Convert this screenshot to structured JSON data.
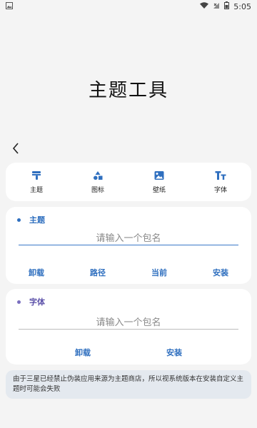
{
  "status_bar": {
    "time": "5:05",
    "icons": [
      "image-icon",
      "wifi-icon",
      "signal-x-icon",
      "battery-icon"
    ]
  },
  "page_title": "主题工具",
  "nav": {
    "items": [
      {
        "label": "主题",
        "icon": "theme-icon"
      },
      {
        "label": "图标",
        "icon": "icons-icon"
      },
      {
        "label": "壁纸",
        "icon": "wallpaper-icon"
      },
      {
        "label": "字体",
        "icon": "font-icon"
      }
    ]
  },
  "theme_section": {
    "title": "主题",
    "input_placeholder": "请输入一个包名",
    "actions": [
      "卸载",
      "路径",
      "当前",
      "安装"
    ]
  },
  "font_section": {
    "title": "字体",
    "input_placeholder": "请输入一个包名",
    "actions": [
      "卸载",
      "安装"
    ]
  },
  "notice": "由于三星已经禁止伪装应用来源为主题商店，所以视系统版本在安装自定义主题时可能会失败",
  "colors": {
    "accent": "#2f6fbf",
    "theme_dot": "#2f6fbf",
    "font_dot": "#7a6fbf",
    "notice_bg": "#e4e9ef"
  }
}
